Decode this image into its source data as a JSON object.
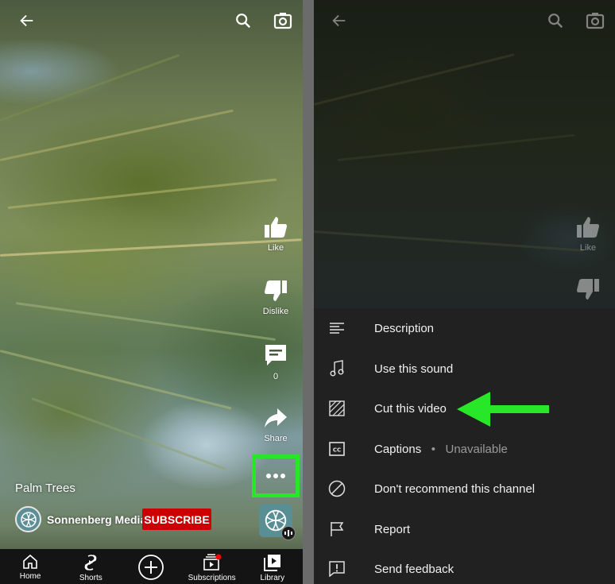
{
  "left_panel": {
    "actions": {
      "like_label": "Like",
      "dislike_label": "Dislike",
      "comments_count": "0",
      "share_label": "Share"
    },
    "video_title": "Palm Trees",
    "channel_name": "Sonnenberg Media",
    "subscribe_label": "SUBSCRIBE",
    "bottom_nav": {
      "home": "Home",
      "shorts": "Shorts",
      "subscriptions": "Subscriptions",
      "library": "Library"
    },
    "colors": {
      "highlight": "#28e628",
      "subscribe": "#cc0000",
      "notification_dot": "#ff0000"
    },
    "icons": [
      "back-arrow-icon",
      "search-icon",
      "camera-icon",
      "thumbs-up-icon",
      "thumbs-down-icon",
      "comment-icon",
      "share-icon",
      "more-icon",
      "home-icon",
      "shorts-icon",
      "create-icon",
      "subscriptions-icon",
      "library-icon"
    ]
  },
  "right_panel": {
    "like_label": "Like",
    "menu": {
      "description": "Description",
      "use_sound": "Use this sound",
      "cut_video": "Cut this video",
      "captions": "Captions",
      "captions_separator": "•",
      "captions_status": "Unavailable",
      "dont_recommend": "Don't recommend this channel",
      "report": "Report",
      "send_feedback": "Send feedback"
    },
    "colors": {
      "menu_background": "#212121",
      "arrow": "#28e628"
    }
  }
}
